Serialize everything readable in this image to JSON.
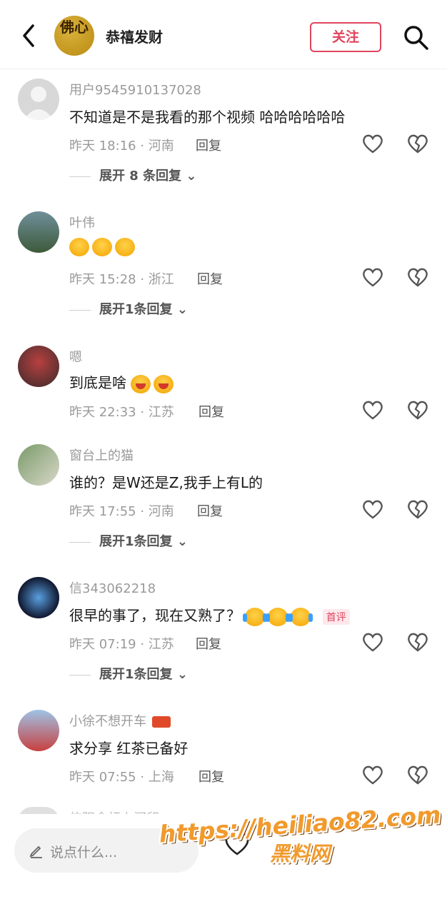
{
  "header": {
    "title": "恭禧发财",
    "avatar_text": "佛心",
    "follow_label": "关注"
  },
  "comments": [
    {
      "user": "用户9545910137028",
      "text": "不知道是不是我看的那个视频  哈哈哈哈哈哈",
      "time": "昨天 18:16 · 河南",
      "reply": "回复",
      "expand": "展开 8 条回复"
    },
    {
      "user": "叶伟",
      "text": "",
      "time": "昨天 15:28 · 浙江",
      "reply": "回复",
      "expand": "展开1条回复"
    },
    {
      "user": "嗯",
      "text": "到底是啥",
      "time": "昨天 22:33 · 江苏",
      "reply": "回复"
    },
    {
      "user": "窗台上的猫",
      "text": "谁的？是W还是Z,我手上有L的",
      "time": "昨天 17:55 · 河南",
      "reply": "回复",
      "expand": "展开1条回复"
    },
    {
      "user": "信343062218",
      "text": "很早的事了，现在又熟了？",
      "badge": "首评",
      "time": "昨天 07:19 · 江苏",
      "reply": "回复",
      "expand": "展开1条回复"
    },
    {
      "user": "小徐不想开车",
      "text": "求分享 红茶已备好",
      "time": "昨天 07:55 · 上海",
      "reply": "回复"
    },
    {
      "user": "信阳余杆上河印"
    }
  ],
  "bottom": {
    "input_placeholder": "说点什么..."
  },
  "watermark": {
    "url": "https://heiliao82.com",
    "name": "黑料网"
  },
  "colors": {
    "accent": "#e0455e",
    "watermark": "#f19a2c",
    "gray_text": "#9a9a9a"
  }
}
